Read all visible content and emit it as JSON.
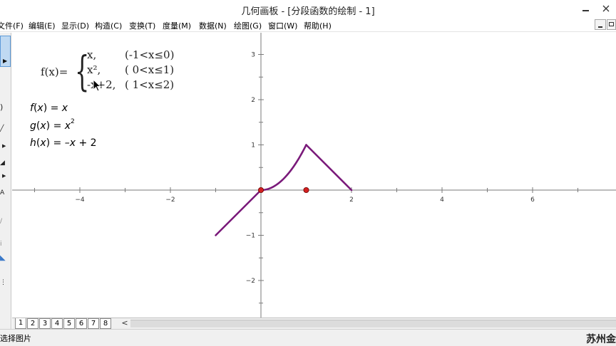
{
  "window": {
    "title": "几何画板 - [分段函数的绘制 - 1]"
  },
  "menu": {
    "items": [
      {
        "label": "文件(F)"
      },
      {
        "label": "编辑(E)"
      },
      {
        "label": "显示(D)"
      },
      {
        "label": "构造(C)"
      },
      {
        "label": "变换(T)"
      },
      {
        "label": "度量(M)"
      },
      {
        "label": "数据(N)"
      },
      {
        "label": "绘图(G)"
      },
      {
        "label": "窗口(W)"
      },
      {
        "label": "帮助(H)"
      }
    ]
  },
  "formula": {
    "lhs": "f(x)=",
    "cases": [
      {
        "expr": "x,",
        "cond": "(-1<x≤0)"
      },
      {
        "expr": "x²,",
        "cond": "( 0<x≤1)"
      },
      {
        "expr": "-x+2,",
        "cond": "( 1<x≤2)"
      }
    ]
  },
  "functions": [
    {
      "name": "f",
      "var": "x",
      "rhs_var": "x",
      "sup": "",
      "tail": ""
    },
    {
      "name": "g",
      "var": "x",
      "rhs_var": "x",
      "sup": "2",
      "tail": ""
    },
    {
      "name": "h",
      "var": "x",
      "rhs_var": "–x",
      "sup": "",
      "tail": " + 2"
    }
  ],
  "graph": {
    "x_ticks": [
      "-4",
      "-2",
      "2",
      "4",
      "6"
    ],
    "y_ticks": [
      "3",
      "2",
      "1",
      "-1",
      "-2"
    ],
    "curve_color": "#7a1a7a",
    "point_color": "#d42020",
    "points": [
      {
        "x": 0,
        "y": 0
      },
      {
        "x": 1,
        "y": 0
      }
    ],
    "x_range": [
      -5.5,
      7.8
    ],
    "y_range": [
      -2.8,
      3.0
    ]
  },
  "page_tabs": [
    "1",
    "2",
    "3",
    "4",
    "5",
    "6",
    "7",
    "8"
  ],
  "tab_scroll_label": "<",
  "status": {
    "text": "选择图片",
    "watermark": "苏州金"
  }
}
